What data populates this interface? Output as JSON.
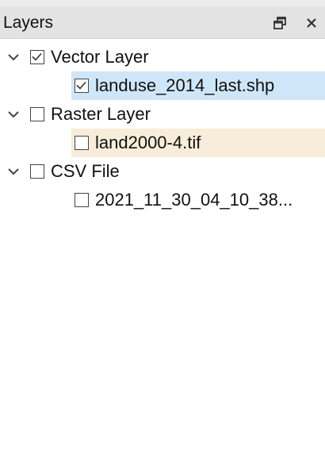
{
  "panel": {
    "title": "Layers",
    "float_icon": "float-window-icon",
    "close_icon": "close-icon"
  },
  "groups": [
    {
      "label": "Vector Layer",
      "checked": true,
      "expanded": true,
      "children": [
        {
          "label": "landuse_2014_last.shp",
          "checked": true,
          "highlight": "#cfe6f8"
        }
      ]
    },
    {
      "label": "Raster Layer",
      "checked": false,
      "expanded": true,
      "children": [
        {
          "label": "land2000-4.tif",
          "checked": false,
          "highlight": "#f7edda"
        }
      ]
    },
    {
      "label": "CSV File",
      "checked": false,
      "expanded": true,
      "children": [
        {
          "label": "2021_11_30_04_10_38...",
          "checked": false
        }
      ]
    }
  ]
}
